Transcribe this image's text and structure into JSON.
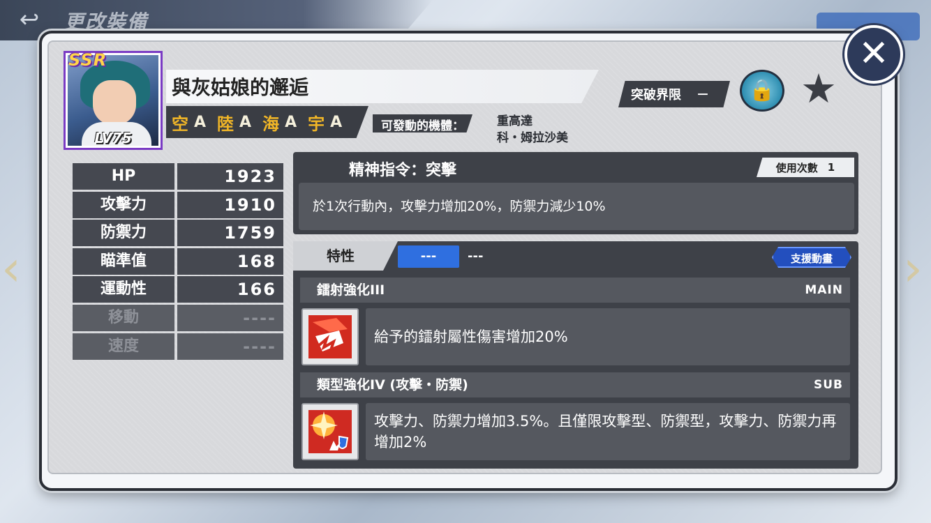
{
  "background": {
    "back_arrow": "↩",
    "screen_title": "更改裝備"
  },
  "character": {
    "rarity": "SSR",
    "level": "LV75",
    "name": "與灰姑娘的邂逅",
    "terrain": [
      {
        "name": "空",
        "rank": "A"
      },
      {
        "name": "陸",
        "rank": "A"
      },
      {
        "name": "海",
        "rank": "A"
      },
      {
        "name": "宇",
        "rank": "A"
      }
    ],
    "available_label": "可發動的機體：",
    "available_units": [
      "重高達",
      "科・姆拉沙美"
    ]
  },
  "controls": {
    "breakthrough_label": "突破界限",
    "breakthrough_value": "－",
    "lock_icon": "lock-icon",
    "star_icon": "star-icon",
    "close_icon": "close-icon"
  },
  "stats": [
    {
      "label": "HP",
      "value": "1923",
      "dim": false
    },
    {
      "label": "攻擊力",
      "value": "1910",
      "dim": false
    },
    {
      "label": "防禦力",
      "value": "1759",
      "dim": false
    },
    {
      "label": "瞄準值",
      "value": "168",
      "dim": false
    },
    {
      "label": "運動性",
      "value": "166",
      "dim": false
    },
    {
      "label": "移動",
      "value": "----",
      "dim": true
    },
    {
      "label": "速度",
      "value": "----",
      "dim": true
    }
  ],
  "spirit": {
    "title": "精神指令：突擊",
    "uses_label": "使用次數",
    "uses_value": "1",
    "description": "於1次行動內，攻擊力增加20%，防禦力減少10%"
  },
  "traits": {
    "header": "特性",
    "tab_active": "---",
    "tab_idle": "---",
    "support_tag": "支援動畫",
    "skills": [
      {
        "name": "鐳射強化III",
        "slot": "MAIN",
        "icon": "laser-icon",
        "description": "給予的鐳射屬性傷害增加20%"
      },
      {
        "name": "類型強化IV (攻擊・防禦)",
        "slot": "SUB",
        "icon": "attack-defense-icon",
        "description": "攻擊力、防禦力增加3.5%。且僅限攻擊型、防禦型，攻擊力、防禦力再增加2%"
      }
    ]
  }
}
